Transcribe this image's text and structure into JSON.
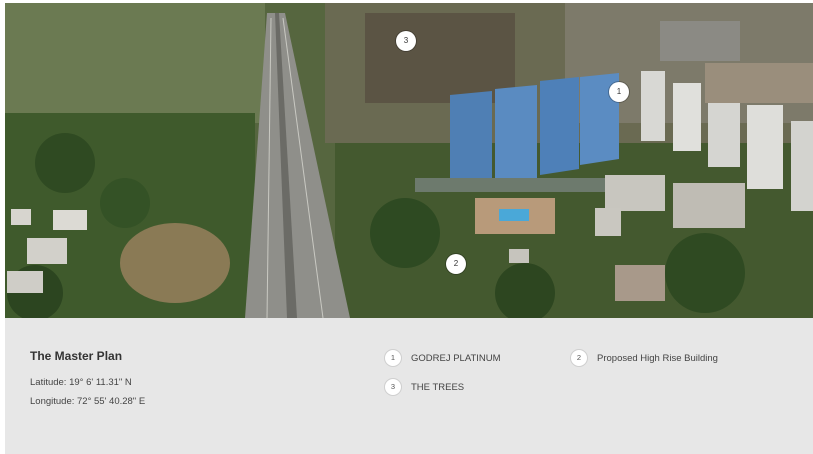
{
  "image": {
    "alt_icon": "aerial-map-photo"
  },
  "markers": [
    {
      "number": "1"
    },
    {
      "number": "2"
    },
    {
      "number": "3"
    }
  ],
  "info": {
    "title": "The Master Plan",
    "latitude": "Latitude: 19° 6' 11.31\" N",
    "longitude": "Longitude: 72° 55' 40.28\" E"
  },
  "legend": [
    {
      "number": "1",
      "label": "GODREJ PLATINUM"
    },
    {
      "number": "2",
      "label": "Proposed High Rise Building"
    },
    {
      "number": "3",
      "label": "THE TREES"
    }
  ],
  "colors": {
    "panel_background": "#e7e7e7",
    "text": "#444444",
    "marker": "#ffffff"
  }
}
